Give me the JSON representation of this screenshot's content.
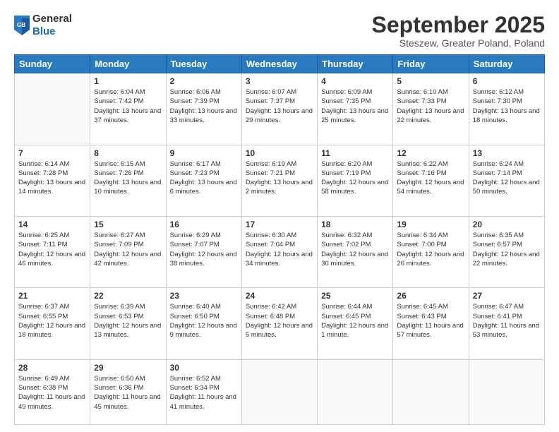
{
  "header": {
    "logo": {
      "line1": "General",
      "line2": "Blue"
    },
    "title": "September 2025",
    "location": "Steszew, Greater Poland, Poland"
  },
  "weekdays": [
    "Sunday",
    "Monday",
    "Tuesday",
    "Wednesday",
    "Thursday",
    "Friday",
    "Saturday"
  ],
  "weeks": [
    [
      {
        "day": "",
        "sunrise": "",
        "sunset": "",
        "daylight": ""
      },
      {
        "day": "1",
        "sunrise": "6:04 AM",
        "sunset": "7:42 PM",
        "daylight": "13 hours and 37 minutes."
      },
      {
        "day": "2",
        "sunrise": "6:06 AM",
        "sunset": "7:39 PM",
        "daylight": "13 hours and 33 minutes."
      },
      {
        "day": "3",
        "sunrise": "6:07 AM",
        "sunset": "7:37 PM",
        "daylight": "13 hours and 29 minutes."
      },
      {
        "day": "4",
        "sunrise": "6:09 AM",
        "sunset": "7:35 PM",
        "daylight": "13 hours and 25 minutes."
      },
      {
        "day": "5",
        "sunrise": "6:10 AM",
        "sunset": "7:33 PM",
        "daylight": "13 hours and 22 minutes."
      },
      {
        "day": "6",
        "sunrise": "6:12 AM",
        "sunset": "7:30 PM",
        "daylight": "13 hours and 18 minutes."
      }
    ],
    [
      {
        "day": "7",
        "sunrise": "6:14 AM",
        "sunset": "7:28 PM",
        "daylight": "13 hours and 14 minutes."
      },
      {
        "day": "8",
        "sunrise": "6:15 AM",
        "sunset": "7:26 PM",
        "daylight": "13 hours and 10 minutes."
      },
      {
        "day": "9",
        "sunrise": "6:17 AM",
        "sunset": "7:23 PM",
        "daylight": "13 hours and 6 minutes."
      },
      {
        "day": "10",
        "sunrise": "6:19 AM",
        "sunset": "7:21 PM",
        "daylight": "13 hours and 2 minutes."
      },
      {
        "day": "11",
        "sunrise": "6:20 AM",
        "sunset": "7:19 PM",
        "daylight": "12 hours and 58 minutes."
      },
      {
        "day": "12",
        "sunrise": "6:22 AM",
        "sunset": "7:16 PM",
        "daylight": "12 hours and 54 minutes."
      },
      {
        "day": "13",
        "sunrise": "6:24 AM",
        "sunset": "7:14 PM",
        "daylight": "12 hours and 50 minutes."
      }
    ],
    [
      {
        "day": "14",
        "sunrise": "6:25 AM",
        "sunset": "7:11 PM",
        "daylight": "12 hours and 46 minutes."
      },
      {
        "day": "15",
        "sunrise": "6:27 AM",
        "sunset": "7:09 PM",
        "daylight": "12 hours and 42 minutes."
      },
      {
        "day": "16",
        "sunrise": "6:29 AM",
        "sunset": "7:07 PM",
        "daylight": "12 hours and 38 minutes."
      },
      {
        "day": "17",
        "sunrise": "6:30 AM",
        "sunset": "7:04 PM",
        "daylight": "12 hours and 34 minutes."
      },
      {
        "day": "18",
        "sunrise": "6:32 AM",
        "sunset": "7:02 PM",
        "daylight": "12 hours and 30 minutes."
      },
      {
        "day": "19",
        "sunrise": "6:34 AM",
        "sunset": "7:00 PM",
        "daylight": "12 hours and 26 minutes."
      },
      {
        "day": "20",
        "sunrise": "6:35 AM",
        "sunset": "6:57 PM",
        "daylight": "12 hours and 22 minutes."
      }
    ],
    [
      {
        "day": "21",
        "sunrise": "6:37 AM",
        "sunset": "6:55 PM",
        "daylight": "12 hours and 18 minutes."
      },
      {
        "day": "22",
        "sunrise": "6:39 AM",
        "sunset": "6:53 PM",
        "daylight": "12 hours and 13 minutes."
      },
      {
        "day": "23",
        "sunrise": "6:40 AM",
        "sunset": "6:50 PM",
        "daylight": "12 hours and 9 minutes."
      },
      {
        "day": "24",
        "sunrise": "6:42 AM",
        "sunset": "6:48 PM",
        "daylight": "12 hours and 5 minutes."
      },
      {
        "day": "25",
        "sunrise": "6:44 AM",
        "sunset": "6:45 PM",
        "daylight": "12 hours and 1 minute."
      },
      {
        "day": "26",
        "sunrise": "6:45 AM",
        "sunset": "6:43 PM",
        "daylight": "11 hours and 57 minutes."
      },
      {
        "day": "27",
        "sunrise": "6:47 AM",
        "sunset": "6:41 PM",
        "daylight": "11 hours and 53 minutes."
      }
    ],
    [
      {
        "day": "28",
        "sunrise": "6:49 AM",
        "sunset": "6:38 PM",
        "daylight": "11 hours and 49 minutes."
      },
      {
        "day": "29",
        "sunrise": "6:50 AM",
        "sunset": "6:36 PM",
        "daylight": "11 hours and 45 minutes."
      },
      {
        "day": "30",
        "sunrise": "6:52 AM",
        "sunset": "6:34 PM",
        "daylight": "11 hours and 41 minutes."
      },
      {
        "day": "",
        "sunrise": "",
        "sunset": "",
        "daylight": ""
      },
      {
        "day": "",
        "sunrise": "",
        "sunset": "",
        "daylight": ""
      },
      {
        "day": "",
        "sunrise": "",
        "sunset": "",
        "daylight": ""
      },
      {
        "day": "",
        "sunrise": "",
        "sunset": "",
        "daylight": ""
      }
    ]
  ]
}
